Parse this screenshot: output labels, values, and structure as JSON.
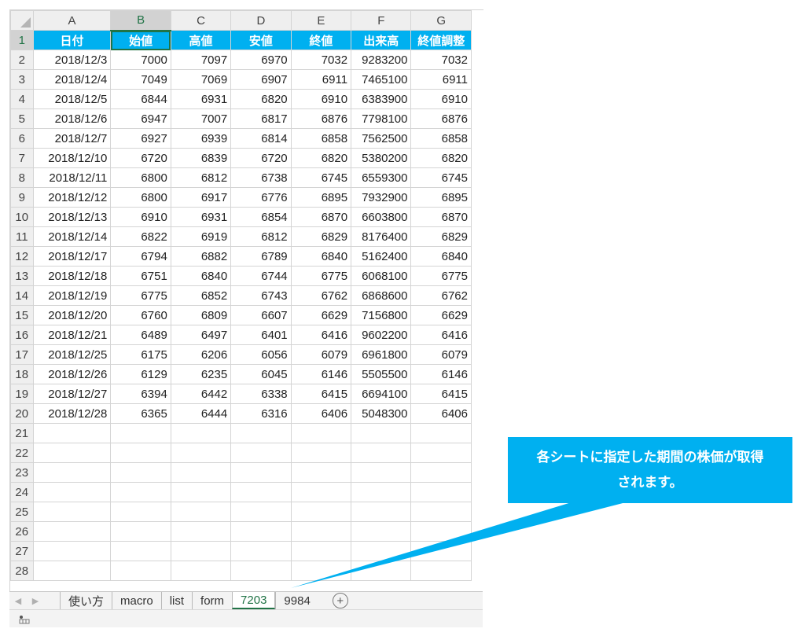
{
  "spreadsheet": {
    "column_headers": [
      "A",
      "B",
      "C",
      "D",
      "E",
      "F",
      "G"
    ],
    "selected_column": "B",
    "selected_row": "1",
    "header_row": [
      "日付",
      "始値",
      "高値",
      "安値",
      "終値",
      "出来高",
      "終値調整"
    ],
    "rows": [
      [
        "2018/12/3",
        "7000",
        "7097",
        "6970",
        "7032",
        "9283200",
        "7032"
      ],
      [
        "2018/12/4",
        "7049",
        "7069",
        "6907",
        "6911",
        "7465100",
        "6911"
      ],
      [
        "2018/12/5",
        "6844",
        "6931",
        "6820",
        "6910",
        "6383900",
        "6910"
      ],
      [
        "2018/12/6",
        "6947",
        "7007",
        "6817",
        "6876",
        "7798100",
        "6876"
      ],
      [
        "2018/12/7",
        "6927",
        "6939",
        "6814",
        "6858",
        "7562500",
        "6858"
      ],
      [
        "2018/12/10",
        "6720",
        "6839",
        "6720",
        "6820",
        "5380200",
        "6820"
      ],
      [
        "2018/12/11",
        "6800",
        "6812",
        "6738",
        "6745",
        "6559300",
        "6745"
      ],
      [
        "2018/12/12",
        "6800",
        "6917",
        "6776",
        "6895",
        "7932900",
        "6895"
      ],
      [
        "2018/12/13",
        "6910",
        "6931",
        "6854",
        "6870",
        "6603800",
        "6870"
      ],
      [
        "2018/12/14",
        "6822",
        "6919",
        "6812",
        "6829",
        "8176400",
        "6829"
      ],
      [
        "2018/12/17",
        "6794",
        "6882",
        "6789",
        "6840",
        "5162400",
        "6840"
      ],
      [
        "2018/12/18",
        "6751",
        "6840",
        "6744",
        "6775",
        "6068100",
        "6775"
      ],
      [
        "2018/12/19",
        "6775",
        "6852",
        "6743",
        "6762",
        "6868600",
        "6762"
      ],
      [
        "2018/12/20",
        "6760",
        "6809",
        "6607",
        "6629",
        "7156800",
        "6629"
      ],
      [
        "2018/12/21",
        "6489",
        "6497",
        "6401",
        "6416",
        "9602200",
        "6416"
      ],
      [
        "2018/12/25",
        "6175",
        "6206",
        "6056",
        "6079",
        "6961800",
        "6079"
      ],
      [
        "2018/12/26",
        "6129",
        "6235",
        "6045",
        "6146",
        "5505500",
        "6146"
      ],
      [
        "2018/12/27",
        "6394",
        "6442",
        "6338",
        "6415",
        "6694100",
        "6415"
      ],
      [
        "2018/12/28",
        "6365",
        "6444",
        "6316",
        "6406",
        "5048300",
        "6406"
      ]
    ],
    "row_numbers": [
      "1",
      "2",
      "3",
      "4",
      "5",
      "6",
      "7",
      "8",
      "9",
      "10",
      "11",
      "12",
      "13",
      "14",
      "15",
      "16",
      "17",
      "18",
      "19",
      "20",
      "21",
      "22",
      "23",
      "24",
      "25",
      "26",
      "27",
      "28"
    ],
    "empty_row_count": 8,
    "header_fill_color": "#00b0f0",
    "accent_color": "#217346"
  },
  "sheet_tabs": {
    "tabs": [
      "使い方",
      "macro",
      "list",
      "form",
      "7203",
      "9984"
    ],
    "active": "7203",
    "add_icon": "plus-circle-icon",
    "nav_icons": [
      "prev-sheet-icon",
      "next-sheet-icon"
    ]
  },
  "statusbar": {
    "icon": "cell-mode-icon"
  },
  "callout": {
    "line1": "各シートに指定した期間の株価が取得",
    "line2": "されます。",
    "color": "#00b0f0"
  }
}
